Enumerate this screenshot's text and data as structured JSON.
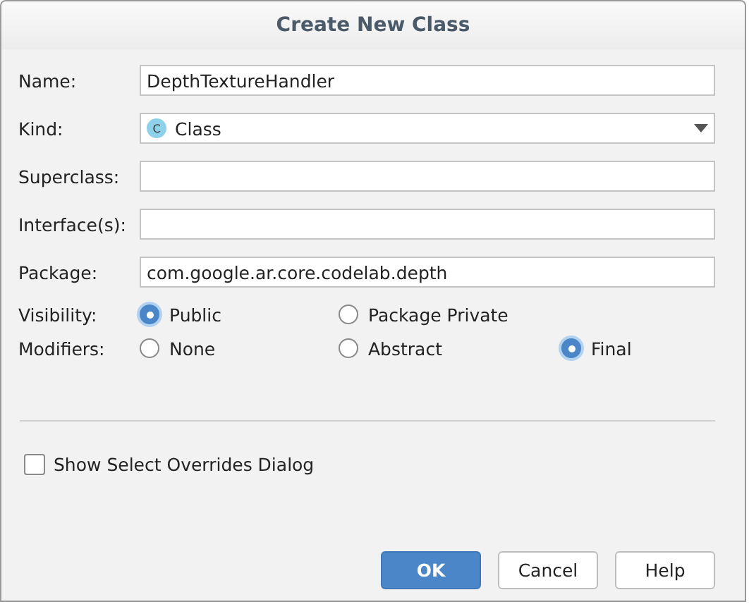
{
  "window": {
    "title": "Create New Class"
  },
  "fields": [
    {
      "label": "Name:",
      "kind": "text",
      "value": "DepthTextureHandler"
    },
    {
      "label": "Kind:",
      "kind": "dropdown",
      "value": "Class",
      "icon_letter": "C"
    },
    {
      "label": "Superclass:",
      "kind": "text"
    },
    {
      "label": "Interface(s):",
      "kind": "text"
    },
    {
      "label": "Package:",
      "kind": "text",
      "value": "com.google.ar.core.codelab.depth"
    }
  ],
  "radio_groups": [
    {
      "label": "Visibility:",
      "options": [
        {
          "label": "Public",
          "selected": true
        },
        {
          "label": "Package Private",
          "selected": false
        }
      ]
    },
    {
      "label": "Modifiers:",
      "options": [
        {
          "label": "None",
          "selected": false
        },
        {
          "label": "Abstract",
          "selected": false
        },
        {
          "label": "Final",
          "selected": true
        }
      ]
    }
  ],
  "checkbox": {
    "label": "Show Select Overrides Dialog",
    "checked": false
  },
  "buttons": [
    {
      "label": "OK",
      "kind": "primary"
    },
    {
      "label": "Cancel",
      "kind": "normal"
    },
    {
      "label": "Help",
      "kind": "normal"
    }
  ]
}
